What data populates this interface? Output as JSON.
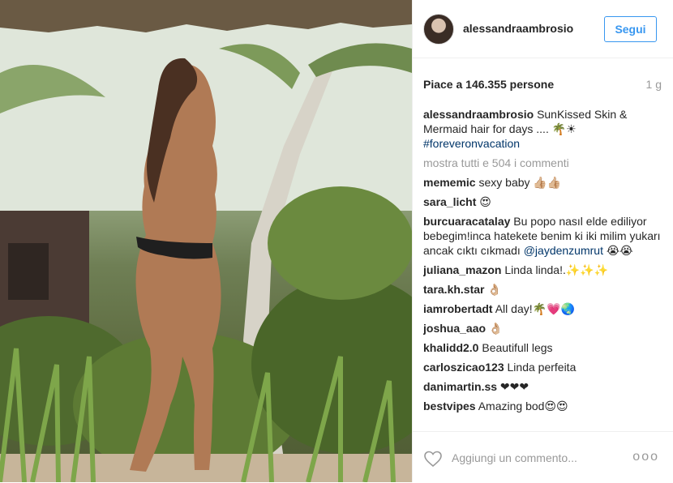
{
  "header": {
    "username": "alessandraambrosio",
    "follow_label": "Segui"
  },
  "stats": {
    "likes_text": "Piace a 146.355 persone",
    "time_ago": "1 g"
  },
  "caption": {
    "user": "alessandraambrosio",
    "text": "SunKissed Skin & Mermaid hair for days .... 🌴☀",
    "hashtag": "#foreveronvacation"
  },
  "show_all_label": "mostra tutti e 504 i commenti",
  "comments": [
    {
      "user": "mememic",
      "text": "sexy baby 👍🏼👍🏼",
      "mention": ""
    },
    {
      "user": "sara_licht",
      "text": "😍",
      "mention": ""
    },
    {
      "user": "burcuaracatalay",
      "text": "Bu popo nasıl elde ediliyor bebegim!inca hatekete benim ki iki milim yukarı ancak cıktı cıkmadı",
      "mention": "@jaydenzumrut",
      "suffix": "😭😭"
    },
    {
      "user": "juliana_mazon",
      "text": "Linda linda!.✨✨✨",
      "mention": ""
    },
    {
      "user": "tara.kh.star",
      "text": "👌🏼",
      "mention": ""
    },
    {
      "user": "iamrobertadt",
      "text": "All day!🌴💗🌏",
      "mention": ""
    },
    {
      "user": "joshua_aao",
      "text": "👌🏼",
      "mention": ""
    },
    {
      "user": "khalidd2.0",
      "text": "Beautifull legs",
      "mention": ""
    },
    {
      "user": "carloszicao123",
      "text": "Linda perfeita",
      "mention": ""
    },
    {
      "user": "danimartin.ss",
      "text": "❤❤❤",
      "mention": ""
    },
    {
      "user": "bestvipes",
      "text": "Amazing bod😍😍",
      "mention": ""
    }
  ],
  "footer": {
    "comment_placeholder": "Aggiungi un commento...",
    "options_label": "ooo",
    "heart_icon": "heart-icon"
  }
}
